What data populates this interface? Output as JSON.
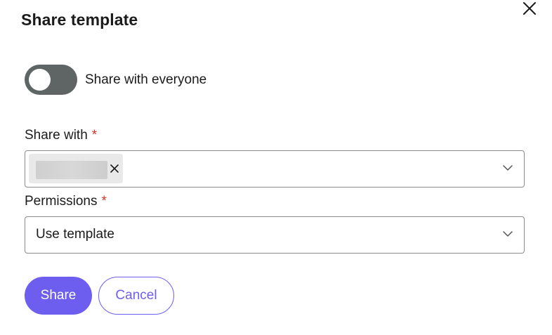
{
  "dialog": {
    "title": "Share template",
    "close_icon": "close-icon"
  },
  "toggle": {
    "label": "Share with everyone",
    "state": "off",
    "track_color": "#5f6565"
  },
  "share_with": {
    "label": "Share with",
    "required_mark": "*",
    "selected_chip_icon": "close-icon",
    "dropdown_icon": "chevron-down-icon"
  },
  "permissions": {
    "label": "Permissions",
    "required_mark": "*",
    "value": "Use template",
    "dropdown_icon": "chevron-down-icon"
  },
  "actions": {
    "share_label": "Share",
    "cancel_label": "Cancel",
    "accent_color": "#6d5ef0"
  },
  "colors": {
    "required": "#d1352b",
    "border": "#8a8a8a",
    "chip_bg": "#e9e9e9"
  }
}
